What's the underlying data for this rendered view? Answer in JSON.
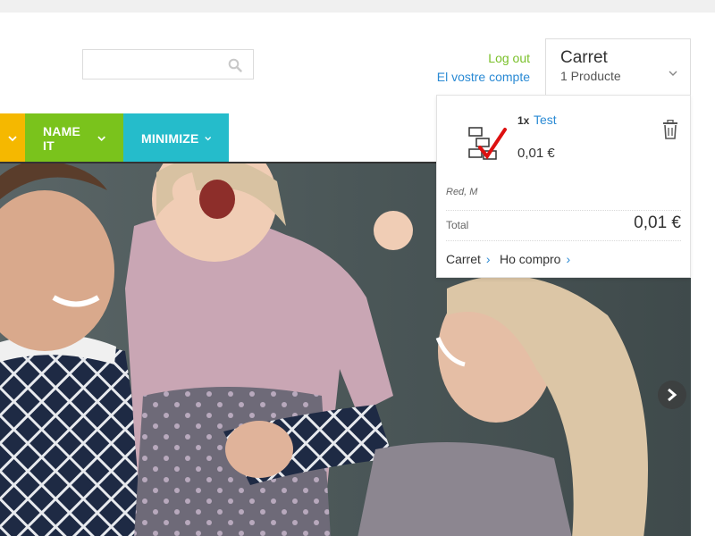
{
  "header": {
    "search": {
      "placeholder": "",
      "value": "",
      "icon": "search-icon"
    },
    "account": {
      "logout_label": "Log out",
      "account_label": "El vostre compte"
    },
    "cart": {
      "title": "Carret",
      "count_label": "1 Producte",
      "icon": "chevron-down-icon"
    }
  },
  "nav": {
    "items": [
      {
        "label": "",
        "color": "#f5b800"
      },
      {
        "label": "NAME IT",
        "color": "#7ac31c"
      },
      {
        "label": "MINIMIZE",
        "color": "#25bccb"
      }
    ]
  },
  "cart_dropdown": {
    "item": {
      "qty": "1x",
      "name": "Test",
      "price": "0,01 €",
      "variant": "Red, M"
    },
    "total_label": "Total",
    "total_value": "0,01 €",
    "cart_link": "Carret",
    "checkout_link": "Ho compro",
    "link_chevron": "›"
  },
  "hero": {
    "next_icon": "chevron-right-icon"
  },
  "colors": {
    "link_blue": "#2a8ad4",
    "logout_green": "#7ac02a"
  }
}
